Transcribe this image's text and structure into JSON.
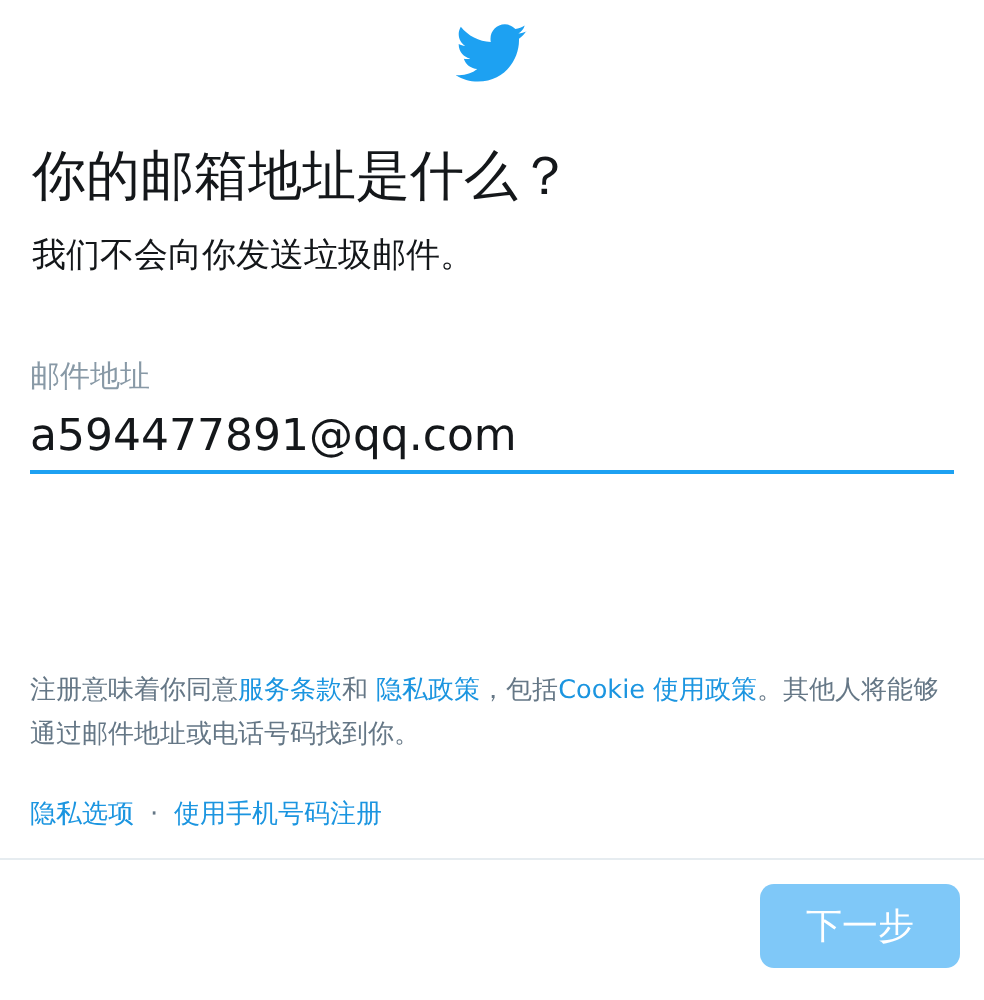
{
  "title": "你的邮箱地址是什么？",
  "subtitle": "我们不会向你发送垃圾邮件。",
  "email_field": {
    "label": "邮件地址",
    "value": "a594477891@qq.com"
  },
  "terms": [
    {
      "text": "注册意味着你同意",
      "link": false
    },
    {
      "text": "服务条款",
      "link": true
    },
    {
      "text": "和 ",
      "link": false
    },
    {
      "text": "隐私政策",
      "link": true
    },
    {
      "text": "，包括",
      "link": false
    },
    {
      "text": "Cookie 使用政策",
      "link": true
    },
    {
      "text": "。其他人将能够通过邮件地址或电话号码找到你。",
      "link": false
    }
  ],
  "footer_links": [
    {
      "text": "隐私选项"
    },
    {
      "text": "使用手机号码注册"
    }
  ],
  "separator": "·",
  "next_button": {
    "label": "下一步",
    "disabled": true
  }
}
